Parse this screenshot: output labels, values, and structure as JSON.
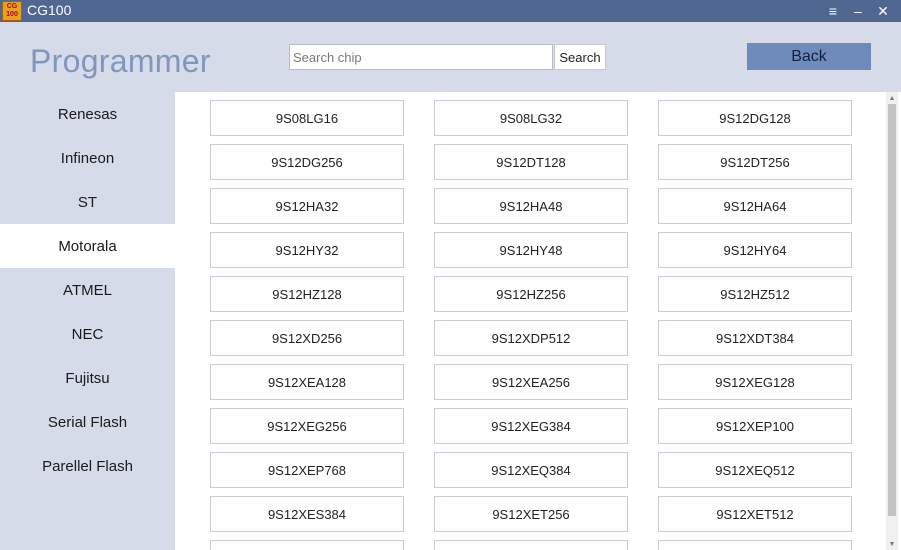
{
  "window": {
    "logo_text": "CG\n100",
    "title": "CG100",
    "menu_glyph": "≡",
    "minimize_glyph": "–",
    "close_glyph": "✕"
  },
  "header": {
    "page_title": "Programmer",
    "search_placeholder": "Search chip",
    "search_label": "Search",
    "back_label": "Back"
  },
  "sidebar": {
    "items": [
      {
        "label": "Renesas",
        "active": false
      },
      {
        "label": "Infineon",
        "active": false
      },
      {
        "label": "ST",
        "active": false
      },
      {
        "label": "Motorala",
        "active": true
      },
      {
        "label": "ATMEL",
        "active": false
      },
      {
        "label": "NEC",
        "active": false
      },
      {
        "label": "Fujitsu",
        "active": false
      },
      {
        "label": "Serial Flash",
        "active": false
      },
      {
        "label": "Parellel Flash",
        "active": false
      }
    ]
  },
  "chips": [
    "9S08LG16",
    "9S08LG32",
    "9S12DG128",
    "9S12DG256",
    "9S12DT128",
    "9S12DT256",
    "9S12HA32",
    "9S12HA48",
    "9S12HA64",
    "9S12HY32",
    "9S12HY48",
    "9S12HY64",
    "9S12HZ128",
    "9S12HZ256",
    "9S12HZ512",
    "9S12XD256",
    "9S12XDP512",
    "9S12XDT384",
    "9S12XEA128",
    "9S12XEA256",
    "9S12XEG128",
    "9S12XEG256",
    "9S12XEG384",
    "9S12XEP100",
    "9S12XEP768",
    "9S12XEQ384",
    "9S12XEQ512",
    "9S12XES384",
    "9S12XET256",
    "9S12XET512",
    "",
    "",
    ""
  ],
  "scrollbar": {
    "up_glyph": "▲",
    "down_glyph": "▼"
  },
  "colors": {
    "titlebar": "#4f6791",
    "accent": "#6f8bbb",
    "title_text": "#7f97bd",
    "sidebar_bg": "#d5dbe8",
    "active_bg": "#ffffff"
  }
}
